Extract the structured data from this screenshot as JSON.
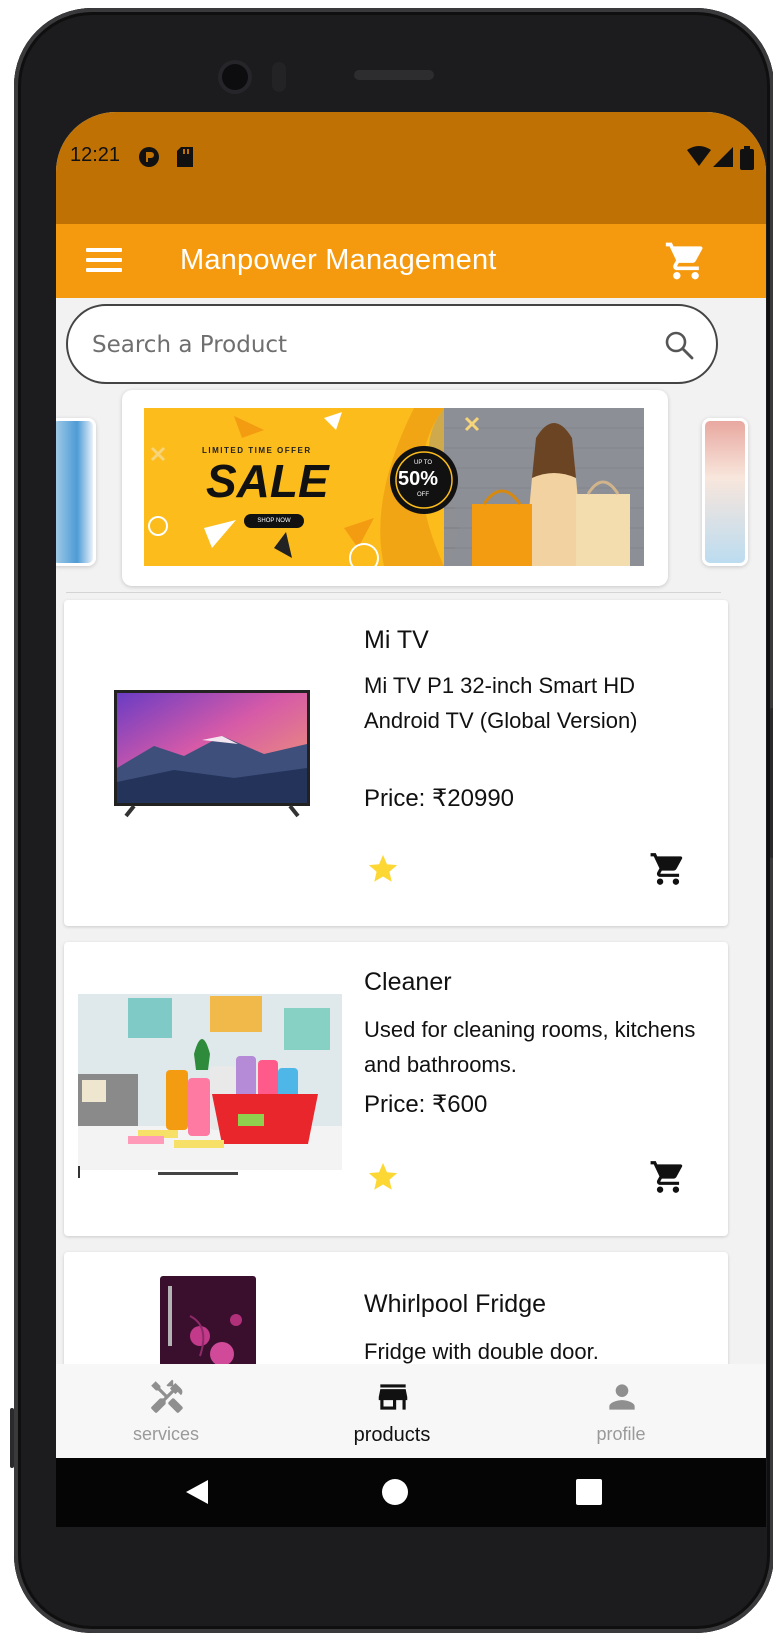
{
  "status_bar": {
    "time": "12:21"
  },
  "app_bar": {
    "title": "Manpower Management"
  },
  "search": {
    "placeholder": "Search a Product"
  },
  "banner": {
    "line1": "LIMITED TIME OFFER",
    "headline": "SALE",
    "badge_top": "UP TO",
    "badge_value": "50%",
    "badge_bottom": "OFF",
    "button": "SHOP NOW"
  },
  "products": [
    {
      "name": "Mi TV",
      "description": "Mi TV P1 32-inch Smart HD Android TV (Global Version)",
      "price": "Price: ₹20990"
    },
    {
      "name": "Cleaner",
      "description": "Used for cleaning rooms, kitchens and bathrooms.",
      "price": "Price: ₹600"
    },
    {
      "name": "Whirlpool Fridge",
      "description": "Fridge with double door."
    }
  ],
  "bottom_nav": [
    {
      "label": "services",
      "icon": "tools-icon",
      "active": false
    },
    {
      "label": "products",
      "icon": "store-icon",
      "active": true
    },
    {
      "label": "profile",
      "icon": "person-icon",
      "active": false
    }
  ],
  "colors": {
    "status_bar": "#bf7104",
    "app_bar": "#f59a0f",
    "star": "#fdd835"
  }
}
